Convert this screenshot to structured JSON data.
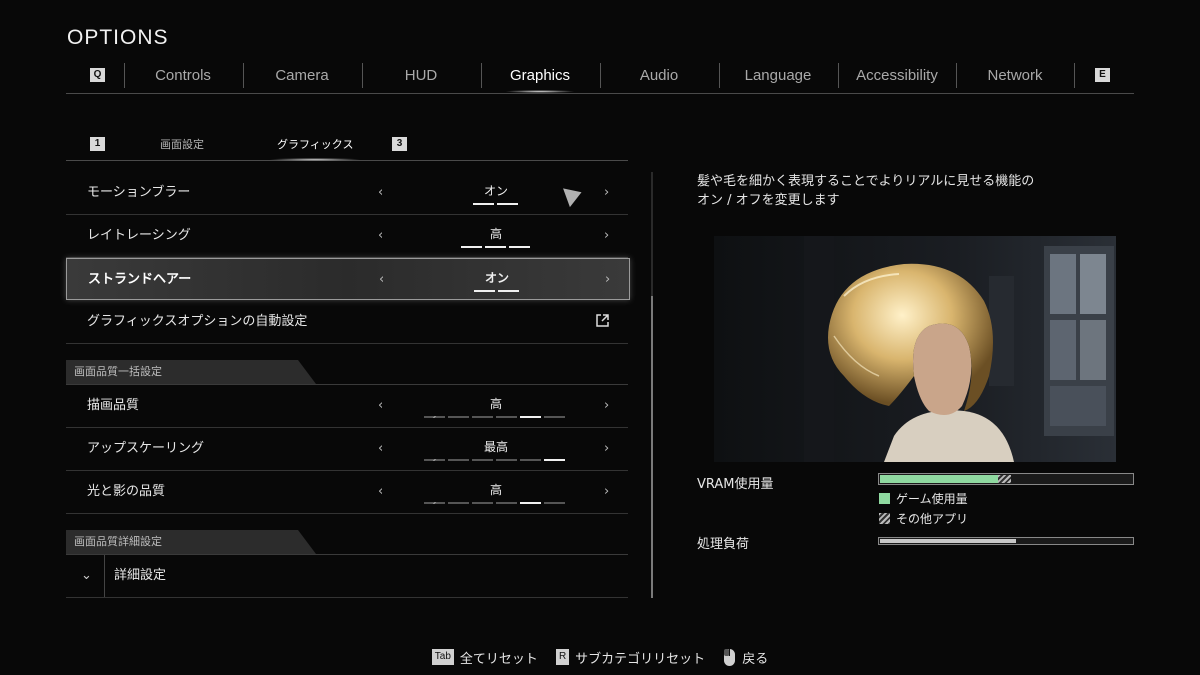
{
  "header": {
    "title": "OPTIONS"
  },
  "tabs": {
    "prev_key": "Q",
    "next_key": "E",
    "items": [
      {
        "label": "Controls"
      },
      {
        "label": "Camera"
      },
      {
        "label": "HUD"
      },
      {
        "label": "Graphics",
        "active": true
      },
      {
        "label": "Audio"
      },
      {
        "label": "Language"
      },
      {
        "label": "Accessibility"
      },
      {
        "label": "Network"
      }
    ]
  },
  "subtabs": {
    "prev_key": "1",
    "next_key": "3",
    "items": [
      {
        "label": "画面設定"
      },
      {
        "label": "グラフィックス",
        "active": true
      }
    ]
  },
  "settings": {
    "motion_blur": {
      "label": "モーションブラー",
      "value": "オン",
      "segments": 2,
      "level": 2
    },
    "ray_tracing": {
      "label": "レイトレーシング",
      "value": "高",
      "segments": 3,
      "level": 3
    },
    "strand_hair": {
      "label": "ストランドヘアー",
      "value": "オン",
      "segments": 2,
      "level": 2
    },
    "auto_config": {
      "label": "グラフィックスオプションの自動設定"
    },
    "section_quality": {
      "label": "画面品質一括設定"
    },
    "render_quality": {
      "label": "描画品質",
      "value": "高",
      "segments": 6,
      "level": 5
    },
    "upscaling": {
      "label": "アップスケーリング",
      "value": "最高",
      "segments": 6,
      "level": 6
    },
    "light_shadow": {
      "label": "光と影の品質",
      "value": "高",
      "segments": 6,
      "level": 5
    },
    "section_detail": {
      "label": "画面品質詳細設定"
    },
    "detail": {
      "label": "詳細設定"
    },
    "arrow_left": "‹",
    "arrow_right": "›",
    "chevron": "⌄"
  },
  "description": {
    "line1": "髪や毛を細かく表現することでよりリアルに見せる機能の",
    "line2": "オン / オフを変更します"
  },
  "vram": {
    "label": "VRAM使用量",
    "game_usage": 0.47,
    "other_usage": 0.05,
    "legend_game": "ゲーム使用量",
    "legend_other": "その他アプリ",
    "game_color": "#8fd9a0"
  },
  "load": {
    "label": "処理負荷",
    "level": 0.54
  },
  "footer": {
    "reset_all_key": "Tab",
    "reset_all": "全てリセット",
    "reset_sub_key": "R",
    "reset_sub": "サブカテゴリリセット",
    "back": "戻る"
  }
}
